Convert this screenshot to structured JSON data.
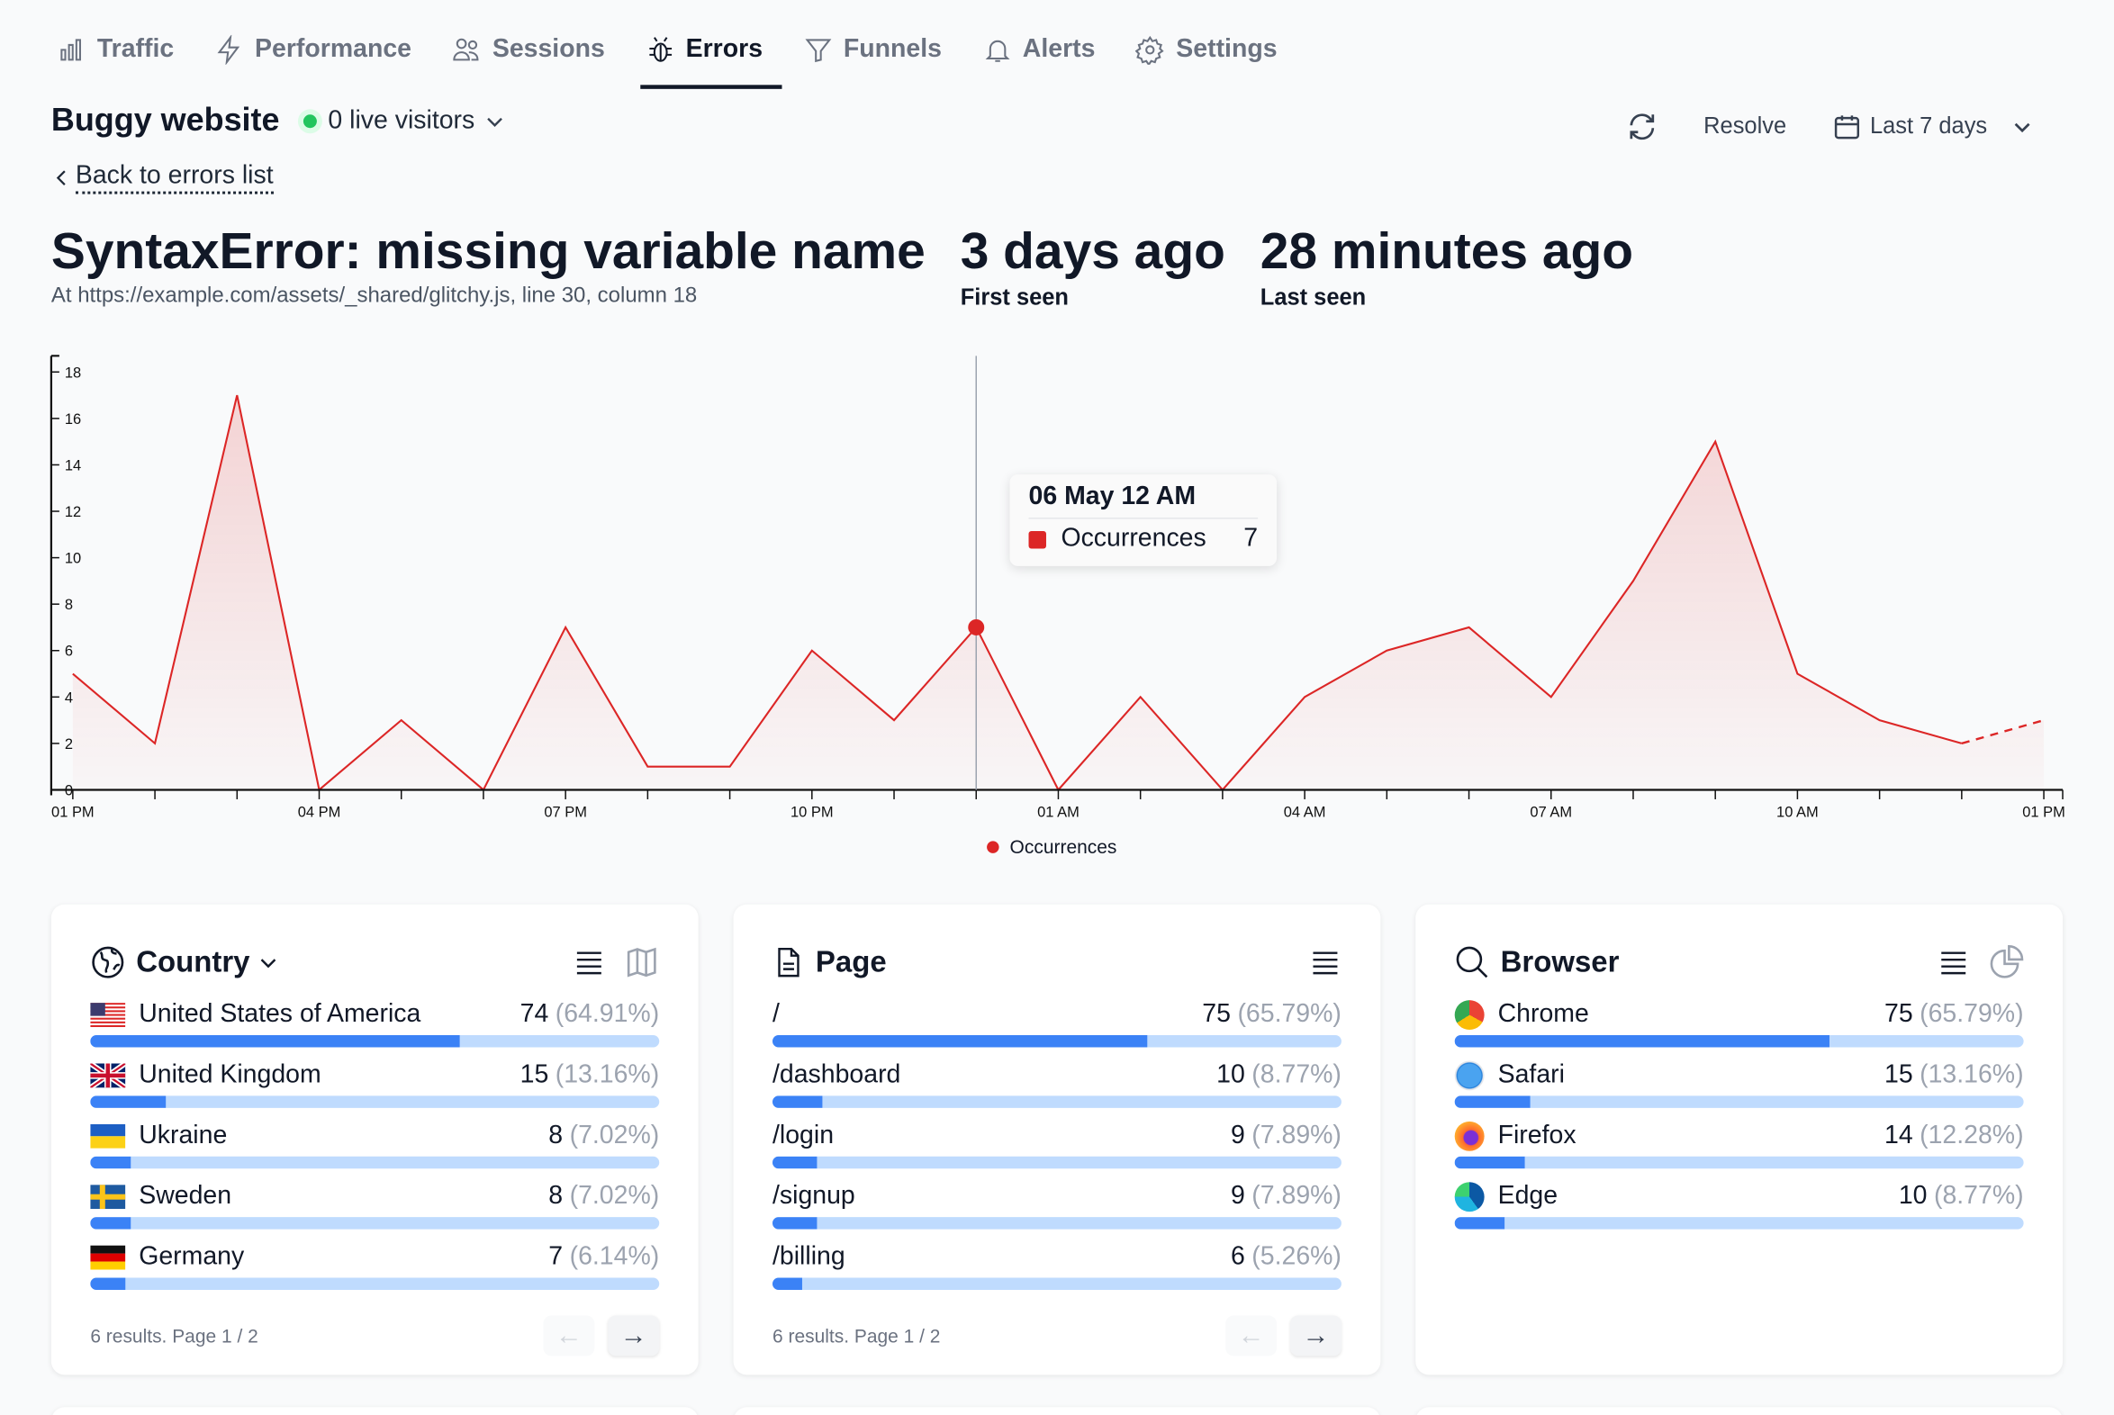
{
  "nav": {
    "tabs": [
      {
        "label": "Traffic",
        "icon": "bar-chart-icon",
        "active": false
      },
      {
        "label": "Performance",
        "icon": "lightning-icon",
        "active": false
      },
      {
        "label": "Sessions",
        "icon": "users-icon",
        "active": false
      },
      {
        "label": "Errors",
        "icon": "bug-icon",
        "active": true
      },
      {
        "label": "Funnels",
        "icon": "funnel-icon",
        "active": false
      },
      {
        "label": "Alerts",
        "icon": "bell-icon",
        "active": false
      },
      {
        "label": "Settings",
        "icon": "gear-icon",
        "active": false
      }
    ]
  },
  "site": {
    "name": "Buggy website",
    "live_visitors": "0 live visitors"
  },
  "actions": {
    "resolve": "Resolve",
    "range": "Last 7 days"
  },
  "back_link": "Back to errors list",
  "error": {
    "title": "SyntaxError: missing variable name",
    "location": "At https://example.com/assets/_shared/glitchy.js, line 30, column 18",
    "first_seen": "3 days ago",
    "first_seen_label": "First seen",
    "last_seen": "28 minutes ago",
    "last_seen_label": "Last seen"
  },
  "colors": {
    "series": "#dc2626",
    "bar_fill": "#3b82f6",
    "bar_track": "#bfdbfe",
    "live": "#22c55e"
  },
  "chart_data": {
    "type": "area",
    "x": [
      "01 PM",
      "02 PM",
      "03 PM",
      "04 PM",
      "05 PM",
      "06 PM",
      "07 PM",
      "08 PM",
      "09 PM",
      "10 PM",
      "11 PM",
      "12 AM",
      "01 AM",
      "02 AM",
      "03 AM",
      "04 AM",
      "05 AM",
      "06 AM",
      "07 AM",
      "08 AM",
      "09 AM",
      "10 AM",
      "11 AM",
      "12 PM",
      "01 PM"
    ],
    "xticklabels": [
      "01 PM",
      "04 PM",
      "07 PM",
      "10 PM",
      "01 AM",
      "04 AM",
      "07 AM",
      "10 AM",
      "01 PM"
    ],
    "series": [
      {
        "name": "Occurrences",
        "values": [
          5,
          2,
          17,
          0,
          3,
          0,
          7,
          1,
          1,
          6,
          3,
          7,
          0,
          4,
          0,
          4,
          6,
          7,
          4,
          9,
          15,
          5,
          3,
          2,
          3
        ]
      }
    ],
    "last_segment_dashed": true,
    "ylim": [
      0,
      18
    ],
    "yticks": [
      0,
      2,
      4,
      6,
      8,
      10,
      12,
      14,
      16,
      18
    ],
    "legend": "bottom",
    "grid": false,
    "tooltip": {
      "title": "06 May 12 AM",
      "label": "Occurrences",
      "value": "7",
      "index": 11
    }
  },
  "cards": {
    "country": {
      "title": "Country",
      "footer": "6 results. Page 1 / 2",
      "rows": [
        {
          "name": "United States of America",
          "count": "74",
          "pct": "(64.91%)",
          "share": 64.91,
          "flag": "us"
        },
        {
          "name": "United Kingdom",
          "count": "15",
          "pct": "(13.16%)",
          "share": 13.16,
          "flag": "gb"
        },
        {
          "name": "Ukraine",
          "count": "8",
          "pct": "(7.02%)",
          "share": 7.02,
          "flag": "ua"
        },
        {
          "name": "Sweden",
          "count": "8",
          "pct": "(7.02%)",
          "share": 7.02,
          "flag": "se"
        },
        {
          "name": "Germany",
          "count": "7",
          "pct": "(6.14%)",
          "share": 6.14,
          "flag": "de"
        }
      ]
    },
    "page": {
      "title": "Page",
      "footer": "6 results. Page 1 / 2",
      "rows": [
        {
          "name": "/",
          "count": "75",
          "pct": "(65.79%)",
          "share": 65.79
        },
        {
          "name": "/dashboard",
          "count": "10",
          "pct": "(8.77%)",
          "share": 8.77
        },
        {
          "name": "/login",
          "count": "9",
          "pct": "(7.89%)",
          "share": 7.89
        },
        {
          "name": "/signup",
          "count": "9",
          "pct": "(7.89%)",
          "share": 7.89
        },
        {
          "name": "/billing",
          "count": "6",
          "pct": "(5.26%)",
          "share": 5.26
        }
      ]
    },
    "browser": {
      "title": "Browser",
      "rows": [
        {
          "name": "Chrome",
          "count": "75",
          "pct": "(65.79%)",
          "share": 65.79,
          "icon": "chrome-icon"
        },
        {
          "name": "Safari",
          "count": "15",
          "pct": "(13.16%)",
          "share": 13.16,
          "icon": "safari-icon"
        },
        {
          "name": "Firefox",
          "count": "14",
          "pct": "(12.28%)",
          "share": 12.28,
          "icon": "firefox-icon"
        },
        {
          "name": "Edge",
          "count": "10",
          "pct": "(8.77%)",
          "share": 8.77,
          "icon": "edge-icon"
        }
      ]
    }
  }
}
